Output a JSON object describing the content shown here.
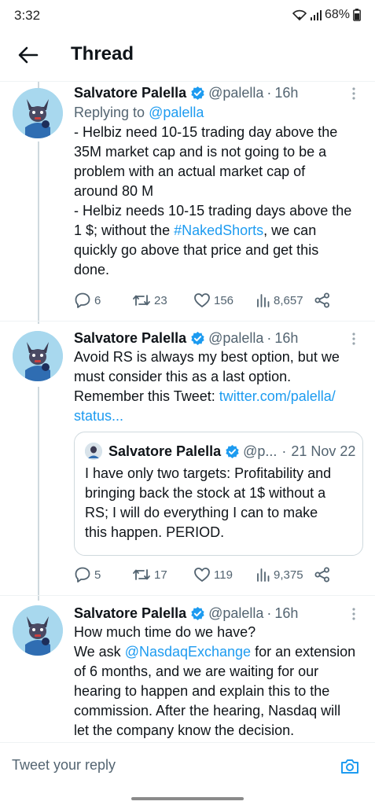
{
  "status_bar": {
    "time": "3:32",
    "battery": "68%"
  },
  "header": {
    "title": "Thread"
  },
  "tweets": [
    {
      "name": "Salvatore Palella",
      "handle": "@palella",
      "dot": "·",
      "time": "16h",
      "replying_prefix": "Replying to",
      "replying_handle": "@palella",
      "lines": [
        "- Helbiz need 10-15 trading day above the",
        "35M market cap and is not going to be a",
        "problem with an actual market cap of",
        "around 80 M",
        "- Helbiz needs 10-15 trading days above the",
        "1 $; without the ",
        "#NakedShorts",
        ", we can",
        "quickly go above that price and get this",
        "done."
      ],
      "replies": "6",
      "retweets": "23",
      "likes": "156",
      "views": "8,657"
    },
    {
      "name": "Salvatore Palella",
      "handle": "@palella",
      "dot": "·",
      "time": "16h",
      "lines": [
        "Avoid RS is always my best option, but we",
        "must consider this as a last option.",
        "Remember this Tweet: ",
        "twitter.com/palella/",
        "status..."
      ],
      "quote": {
        "name": "Salvatore Palella",
        "handle": "@p...",
        "dot": "·",
        "date": "21 Nov 22",
        "lines": [
          "I have only two targets: Profitability and",
          "bringing back the stock at 1$ without a",
          "RS; I will do everything I can to make",
          "this happen. PERIOD."
        ]
      },
      "replies": "5",
      "retweets": "17",
      "likes": "119",
      "views": "9,375"
    },
    {
      "name": "Salvatore Palella",
      "handle": "@palella",
      "dot": "·",
      "time": "16h",
      "lines": [
        "How much time do we have?",
        "We ask ",
        "@NasdaqExchange",
        " for an extension",
        "of 6 months, and we are waiting for our",
        "hearing to happen and explain this to the",
        "commission. After the hearing, Nasdaq will",
        "let the company know the decision."
      ]
    }
  ],
  "composer": {
    "placeholder": "Tweet your reply"
  },
  "colors": {
    "accent": "#1d9bf0",
    "text": "#0f1419",
    "muted": "#536471",
    "border": "#cfd9de"
  },
  "icons": {
    "back": "arrow-left-icon",
    "verified": "verified-badge-icon",
    "more": "more-vertical-icon",
    "reply": "reply-icon",
    "retweet": "retweet-icon",
    "like": "heart-icon",
    "views": "views-icon",
    "share": "share-icon",
    "camera": "camera-icon"
  }
}
